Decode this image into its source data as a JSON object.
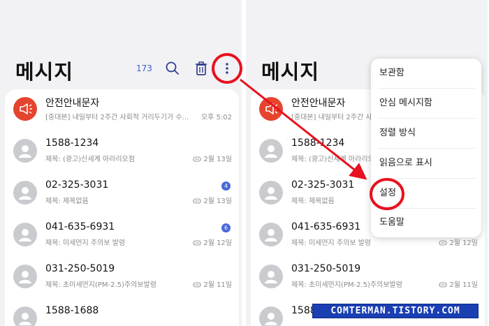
{
  "screen_title": "메시지",
  "unread_count": "173",
  "icons": {
    "search": "search-icon",
    "delete": "trash-icon",
    "more": "more-vertical-icon",
    "attachment": "paperclip-icon",
    "contact": "person-icon",
    "alert": "megaphone-icon"
  },
  "colors": {
    "accent": "#3a5fcf",
    "badge": "#4a68d7",
    "alert_avatar": "#e5442f",
    "annotation": "#e8111f",
    "footer_bg": "#1a3fb3"
  },
  "conversations": [
    {
      "name": "안전안내문자",
      "preview": "[중대본] 내일부터 2주간 사회적 거리두기가 수...",
      "date": "오후 5:02",
      "avatar": "alert"
    },
    {
      "name": "1588-1234",
      "preview": "제목: (광고)신세계 아라리오점",
      "date": "2월 13일",
      "attachment": true
    },
    {
      "name": "02-325-3031",
      "preview": "제목: 제목없음",
      "date": "2월 13일",
      "attachment": true,
      "unread": "4"
    },
    {
      "name": "041-635-6931",
      "preview": "제목: 미세먼지 주의보 발령",
      "date": "2월 12일",
      "attachment": true,
      "unread": "6"
    },
    {
      "name": "031-250-5019",
      "preview": "제목: 초미세먼지(PM-2.5)주의보발령",
      "date": "2월 11일",
      "attachment": true
    },
    {
      "name": "1588-1688",
      "preview": "",
      "date": ""
    }
  ],
  "overflow_menu": {
    "items": [
      "보관함",
      "안심 메시지함",
      "정렬 방식",
      "읽음으로 표시",
      "설정",
      "도움말"
    ],
    "highlighted": "설정"
  },
  "watermark": "COMTERMAN.TISTORY.COM"
}
